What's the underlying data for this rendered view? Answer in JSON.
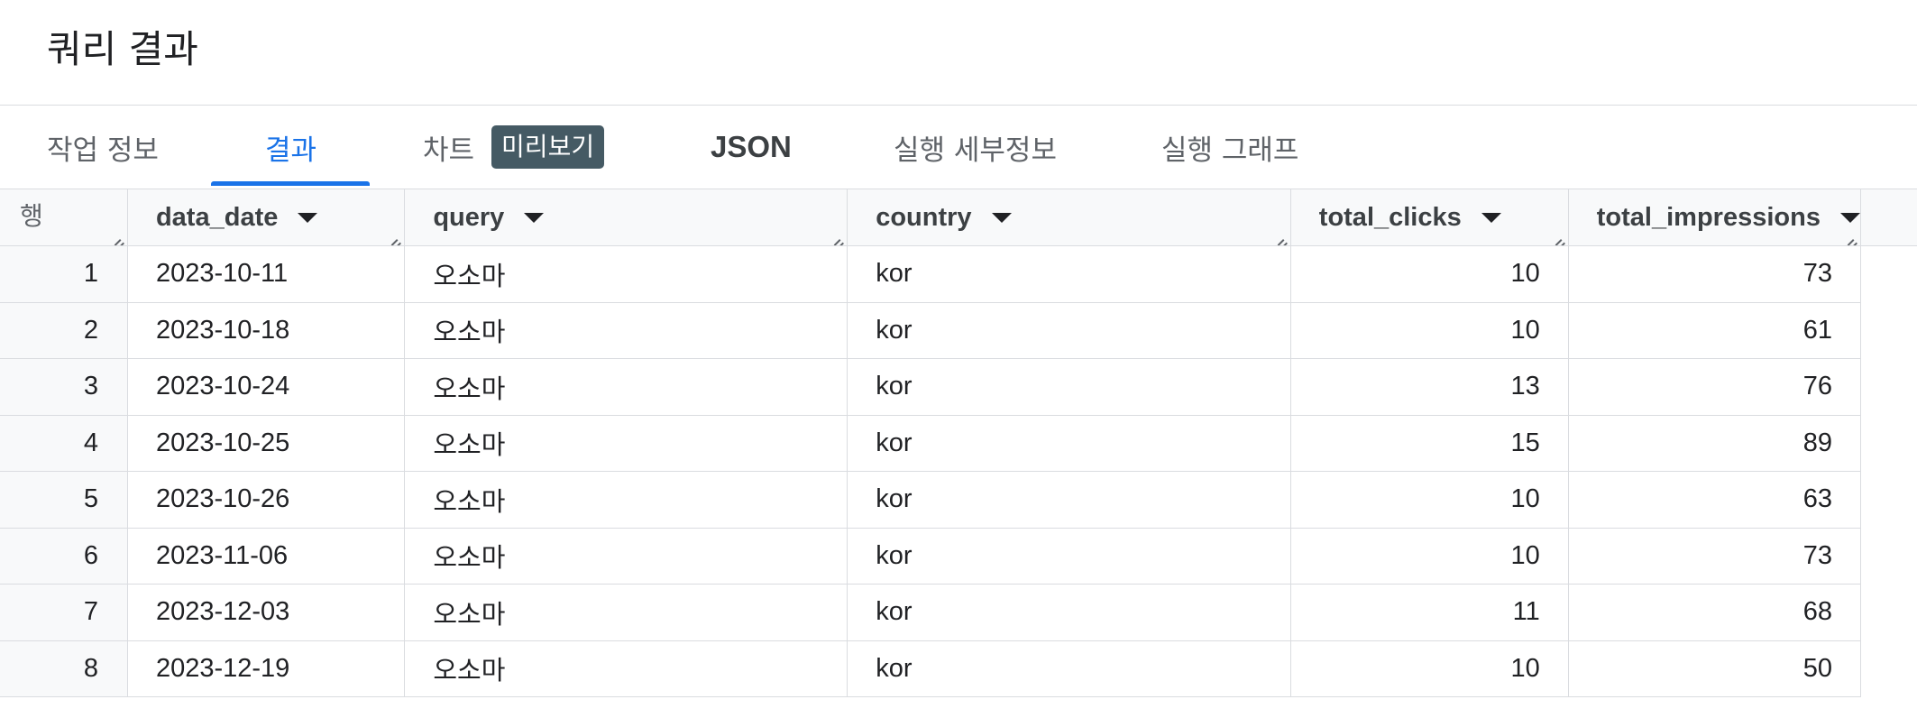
{
  "page": {
    "title": "쿼리 결과"
  },
  "tabs": [
    {
      "label": "작업 정보",
      "active": false
    },
    {
      "label": "결과",
      "active": true
    },
    {
      "label": "차트",
      "active": false,
      "badge": "미리보기"
    },
    {
      "label": "JSON",
      "active": false
    },
    {
      "label": "실행 세부정보",
      "active": false
    },
    {
      "label": "실행 그래프",
      "active": false
    }
  ],
  "table": {
    "row_header": "행",
    "columns": [
      "data_date",
      "query",
      "country",
      "total_clicks",
      "total_impressions"
    ],
    "rows": [
      {
        "row": "1",
        "data_date": "2023-10-11",
        "query": "오소마",
        "country": "kor",
        "total_clicks": "10",
        "total_impressions": "73"
      },
      {
        "row": "2",
        "data_date": "2023-10-18",
        "query": "오소마",
        "country": "kor",
        "total_clicks": "10",
        "total_impressions": "61"
      },
      {
        "row": "3",
        "data_date": "2023-10-24",
        "query": "오소마",
        "country": "kor",
        "total_clicks": "13",
        "total_impressions": "76"
      },
      {
        "row": "4",
        "data_date": "2023-10-25",
        "query": "오소마",
        "country": "kor",
        "total_clicks": "15",
        "total_impressions": "89"
      },
      {
        "row": "5",
        "data_date": "2023-10-26",
        "query": "오소마",
        "country": "kor",
        "total_clicks": "10",
        "total_impressions": "63"
      },
      {
        "row": "6",
        "data_date": "2023-11-06",
        "query": "오소마",
        "country": "kor",
        "total_clicks": "10",
        "total_impressions": "73"
      },
      {
        "row": "7",
        "data_date": "2023-12-03",
        "query": "오소마",
        "country": "kor",
        "total_clicks": "11",
        "total_impressions": "68"
      },
      {
        "row": "8",
        "data_date": "2023-12-19",
        "query": "오소마",
        "country": "kor",
        "total_clicks": "10",
        "total_impressions": "50"
      }
    ]
  },
  "colors": {
    "accent": "#1a73e8",
    "badge_bg": "#455a64",
    "header_bg": "#f8f9fa",
    "border": "#dadce0"
  },
  "icons": {
    "sort": "sort-arrow-down-icon",
    "resize": "column-resize-handle-icon"
  }
}
